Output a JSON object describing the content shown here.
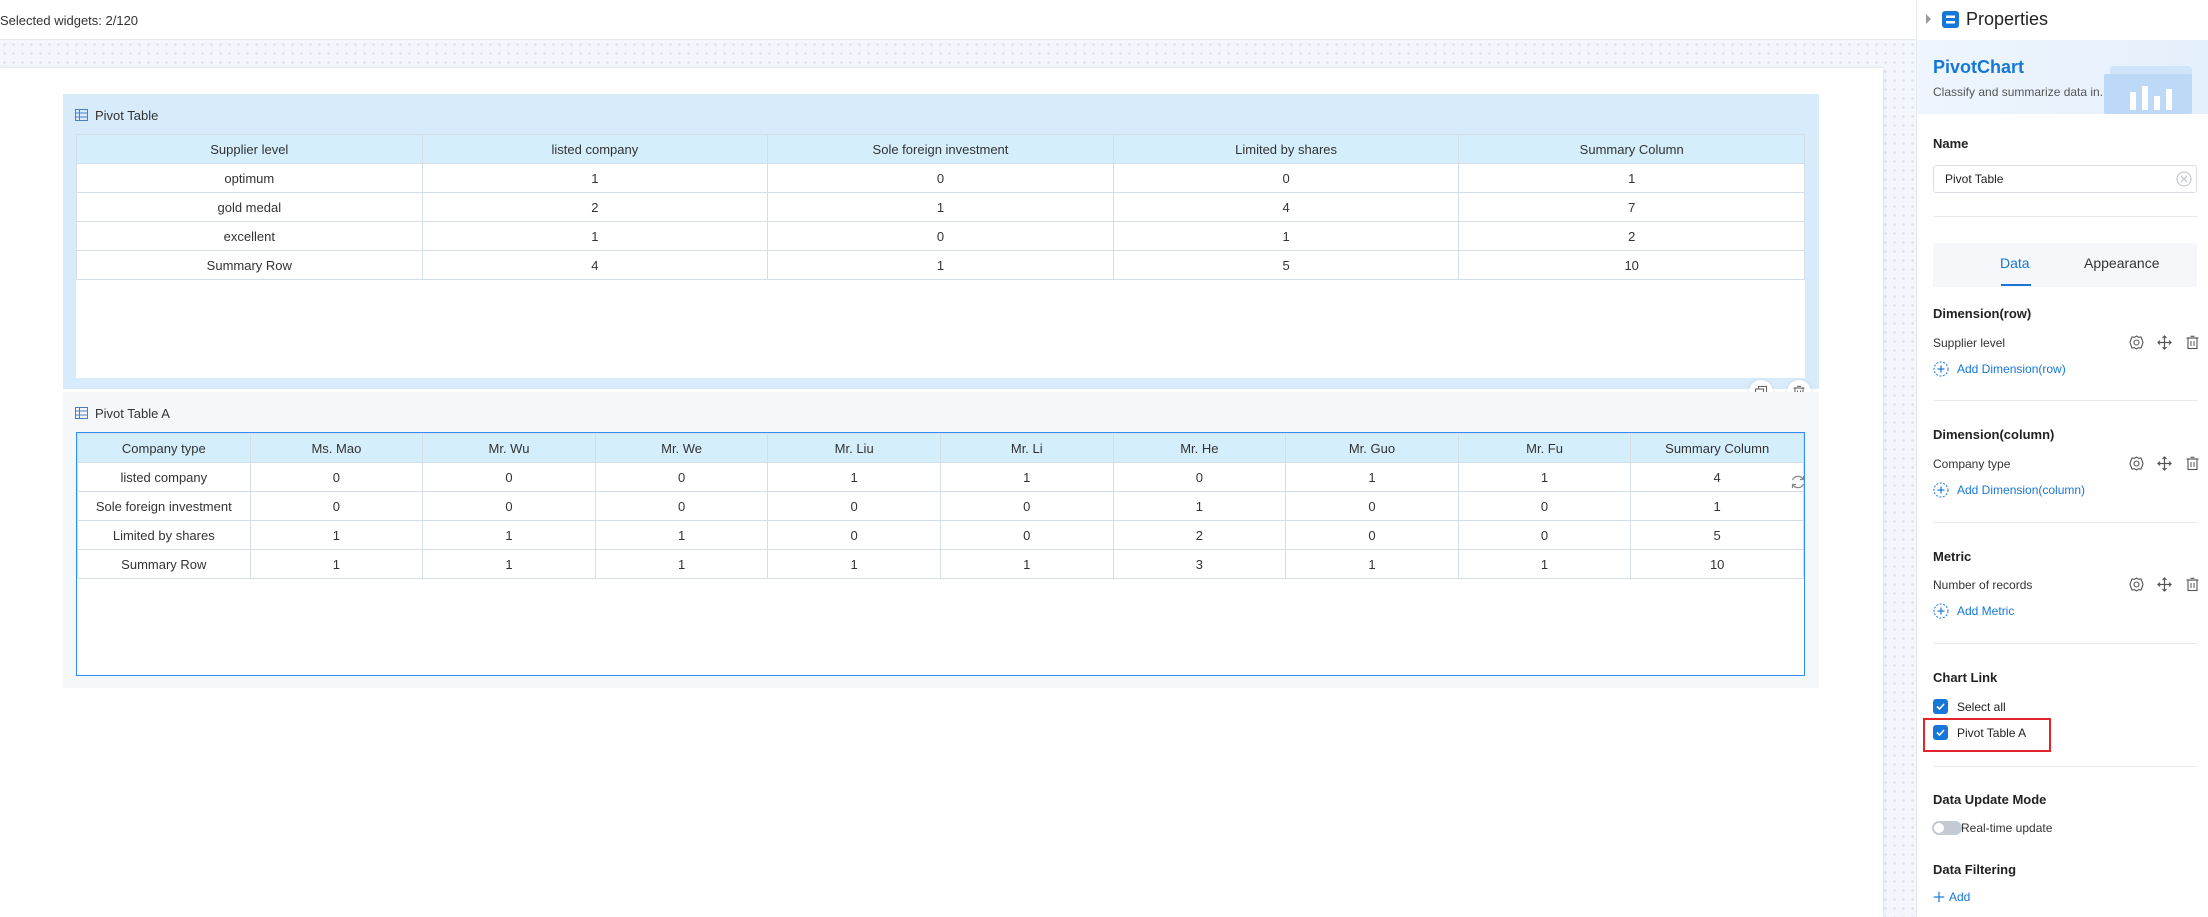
{
  "topbar": {
    "selected_text": "Selected widgets: 2/120"
  },
  "widgets": [
    {
      "title": "Pivot Table",
      "columns": [
        "Supplier level",
        "listed company",
        "Sole foreign investment",
        "Limited by shares",
        "Summary Column"
      ],
      "rows": [
        [
          "optimum",
          "1",
          "0",
          "0",
          "1"
        ],
        [
          "gold medal",
          "2",
          "1",
          "4",
          "7"
        ],
        [
          "excellent",
          "1",
          "0",
          "1",
          "2"
        ],
        [
          "Summary Row",
          "4",
          "1",
          "5",
          "10"
        ]
      ]
    },
    {
      "title": "Pivot Table A",
      "columns": [
        "Company type",
        "Ms. Mao",
        "Mr. Wu",
        "Mr. We",
        "Mr. Liu",
        "Mr. Li",
        "Mr. He",
        "Mr. Guo",
        "Mr. Fu",
        "Summary Column"
      ],
      "rows": [
        [
          "listed company",
          "0",
          "0",
          "0",
          "1",
          "1",
          "0",
          "1",
          "1",
          "4"
        ],
        [
          "Sole foreign investment",
          "0",
          "0",
          "0",
          "0",
          "0",
          "1",
          "0",
          "0",
          "1"
        ],
        [
          "Limited by shares",
          "1",
          "1",
          "1",
          "0",
          "0",
          "2",
          "0",
          "0",
          "5"
        ],
        [
          "Summary Row",
          "1",
          "1",
          "1",
          "1",
          "1",
          "3",
          "1",
          "1",
          "10"
        ]
      ]
    }
  ],
  "panel": {
    "title": "Properties",
    "component": {
      "name": "PivotChart",
      "description": "Classify and summarize data in..."
    },
    "name_label": "Name",
    "name_value": "Pivot Table",
    "tabs": [
      {
        "label": "Data",
        "active": true
      },
      {
        "label": "Appearance",
        "active": false
      }
    ],
    "dimension_row": {
      "label": "Dimension(row)",
      "field": "Supplier level",
      "add": "Add Dimension(row)"
    },
    "dimension_column": {
      "label": "Dimension(column)",
      "field": "Company type",
      "add": "Add Dimension(column)"
    },
    "metric": {
      "label": "Metric",
      "field": "Number of records",
      "add": "Add Metric"
    },
    "chart_link": {
      "label": "Chart Link",
      "select_all": "Select all",
      "item": "Pivot Table A"
    },
    "update_mode": {
      "label": "Data Update Mode",
      "toggle_label": "Real-time update"
    },
    "filtering": {
      "label": "Data Filtering",
      "add": "Add"
    }
  },
  "colors": {
    "accent": "#1677d8",
    "selection_border": "#2f8ef8",
    "header_bg": "#d4eefb",
    "highlight": "#e4242b"
  }
}
